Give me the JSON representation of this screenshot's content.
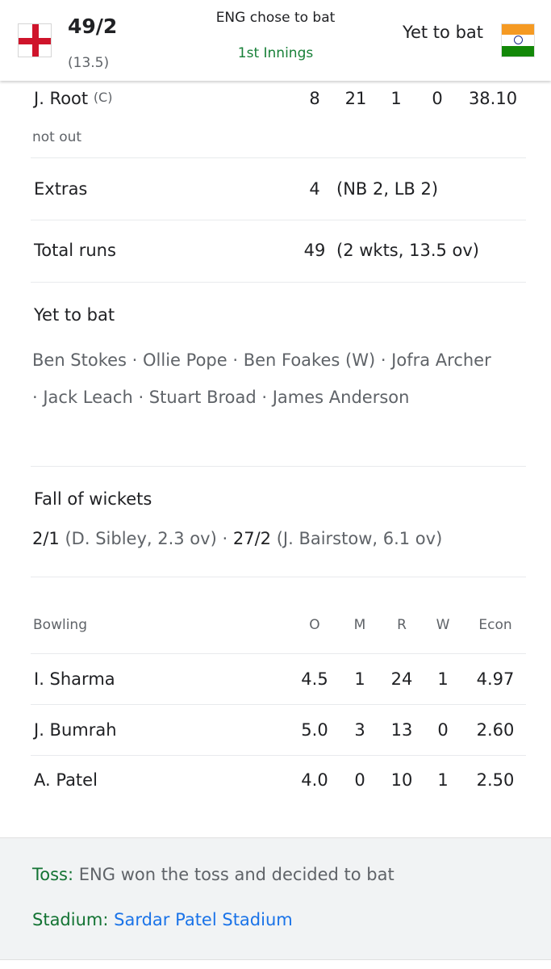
{
  "header": {
    "team1_score": "49/2",
    "team1_overs": "(13.5)",
    "toss_line": "ENG chose to bat",
    "innings": "1st Innings",
    "team2_status": "Yet to bat",
    "team1_flag_icon": "england-flag-icon",
    "team2_flag_icon": "india-flag-icon"
  },
  "batter": {
    "name": "J. Root",
    "captain": "(C)",
    "status": "not out",
    "runs": "8",
    "balls": "21",
    "fours": "1",
    "sixes": "0",
    "strike_rate": "38.10"
  },
  "extras": {
    "label": "Extras",
    "value": "4",
    "detail": "(NB 2, LB 2)"
  },
  "total": {
    "label": "Total runs",
    "value": "49",
    "detail": "(2 wkts, 13.5 ov)"
  },
  "yet_to_bat": {
    "title": "Yet to bat",
    "players": "Ben Stokes · Ollie Pope · Ben Foakes (W) · Jofra Archer · Jack Leach · Stuart Broad · James Anderson"
  },
  "fall_of_wickets": {
    "title": "Fall of wickets",
    "items": [
      {
        "score": "2/1",
        "detail": "(D. Sibley, 2.3 ov)"
      },
      {
        "score": "27/2",
        "detail": "(J. Bairstow, 6.1 ov)"
      }
    ],
    "separator": "·"
  },
  "bowling": {
    "headers": [
      "Bowling",
      "O",
      "M",
      "R",
      "W",
      "Econ"
    ],
    "rows": [
      [
        "I. Sharma",
        "4.5",
        "1",
        "24",
        "1",
        "4.97"
      ],
      [
        "J. Bumrah",
        "5.0",
        "3",
        "13",
        "0",
        "2.60"
      ],
      [
        "A. Patel",
        "4.0",
        "0",
        "10",
        "1",
        "2.50"
      ]
    ]
  },
  "footer": {
    "toss_label": "Toss:",
    "toss_text": "ENG won the toss and decided to bat",
    "stadium_label": "Stadium:",
    "stadium_name": "Sardar Patel Stadium"
  },
  "colors": {
    "innings_green": "#188038",
    "label_green": "#137333",
    "link_blue": "#1a73e8",
    "muted_gray": "#5f6368"
  }
}
